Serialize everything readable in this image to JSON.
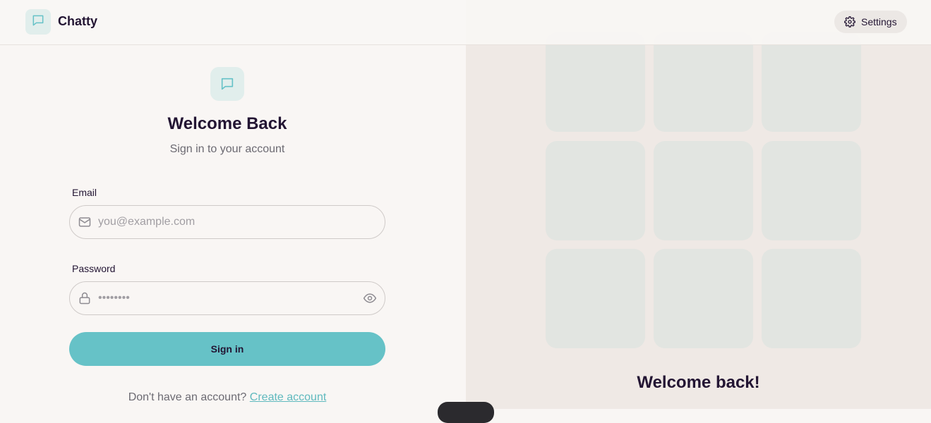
{
  "header": {
    "app_name": "Chatty",
    "settings_label": "Settings"
  },
  "login": {
    "heading": "Welcome Back",
    "subheading": "Sign in to your account",
    "email_label": "Email",
    "email_placeholder": "you@example.com",
    "password_label": "Password",
    "password_placeholder": "••••••••",
    "submit_label": "Sign in",
    "signup_prompt": "Don't have an account?",
    "signup_link": "Create account"
  },
  "promo": {
    "title": "Welcome back!"
  },
  "colors": {
    "accent": "#66c2c7",
    "text": "#231533",
    "muted": "#6c6a72",
    "tile": "#e2e5e1"
  },
  "icons": [
    "chat-bubble-icon",
    "gear-icon",
    "mail-icon",
    "lock-icon",
    "eye-icon"
  ]
}
